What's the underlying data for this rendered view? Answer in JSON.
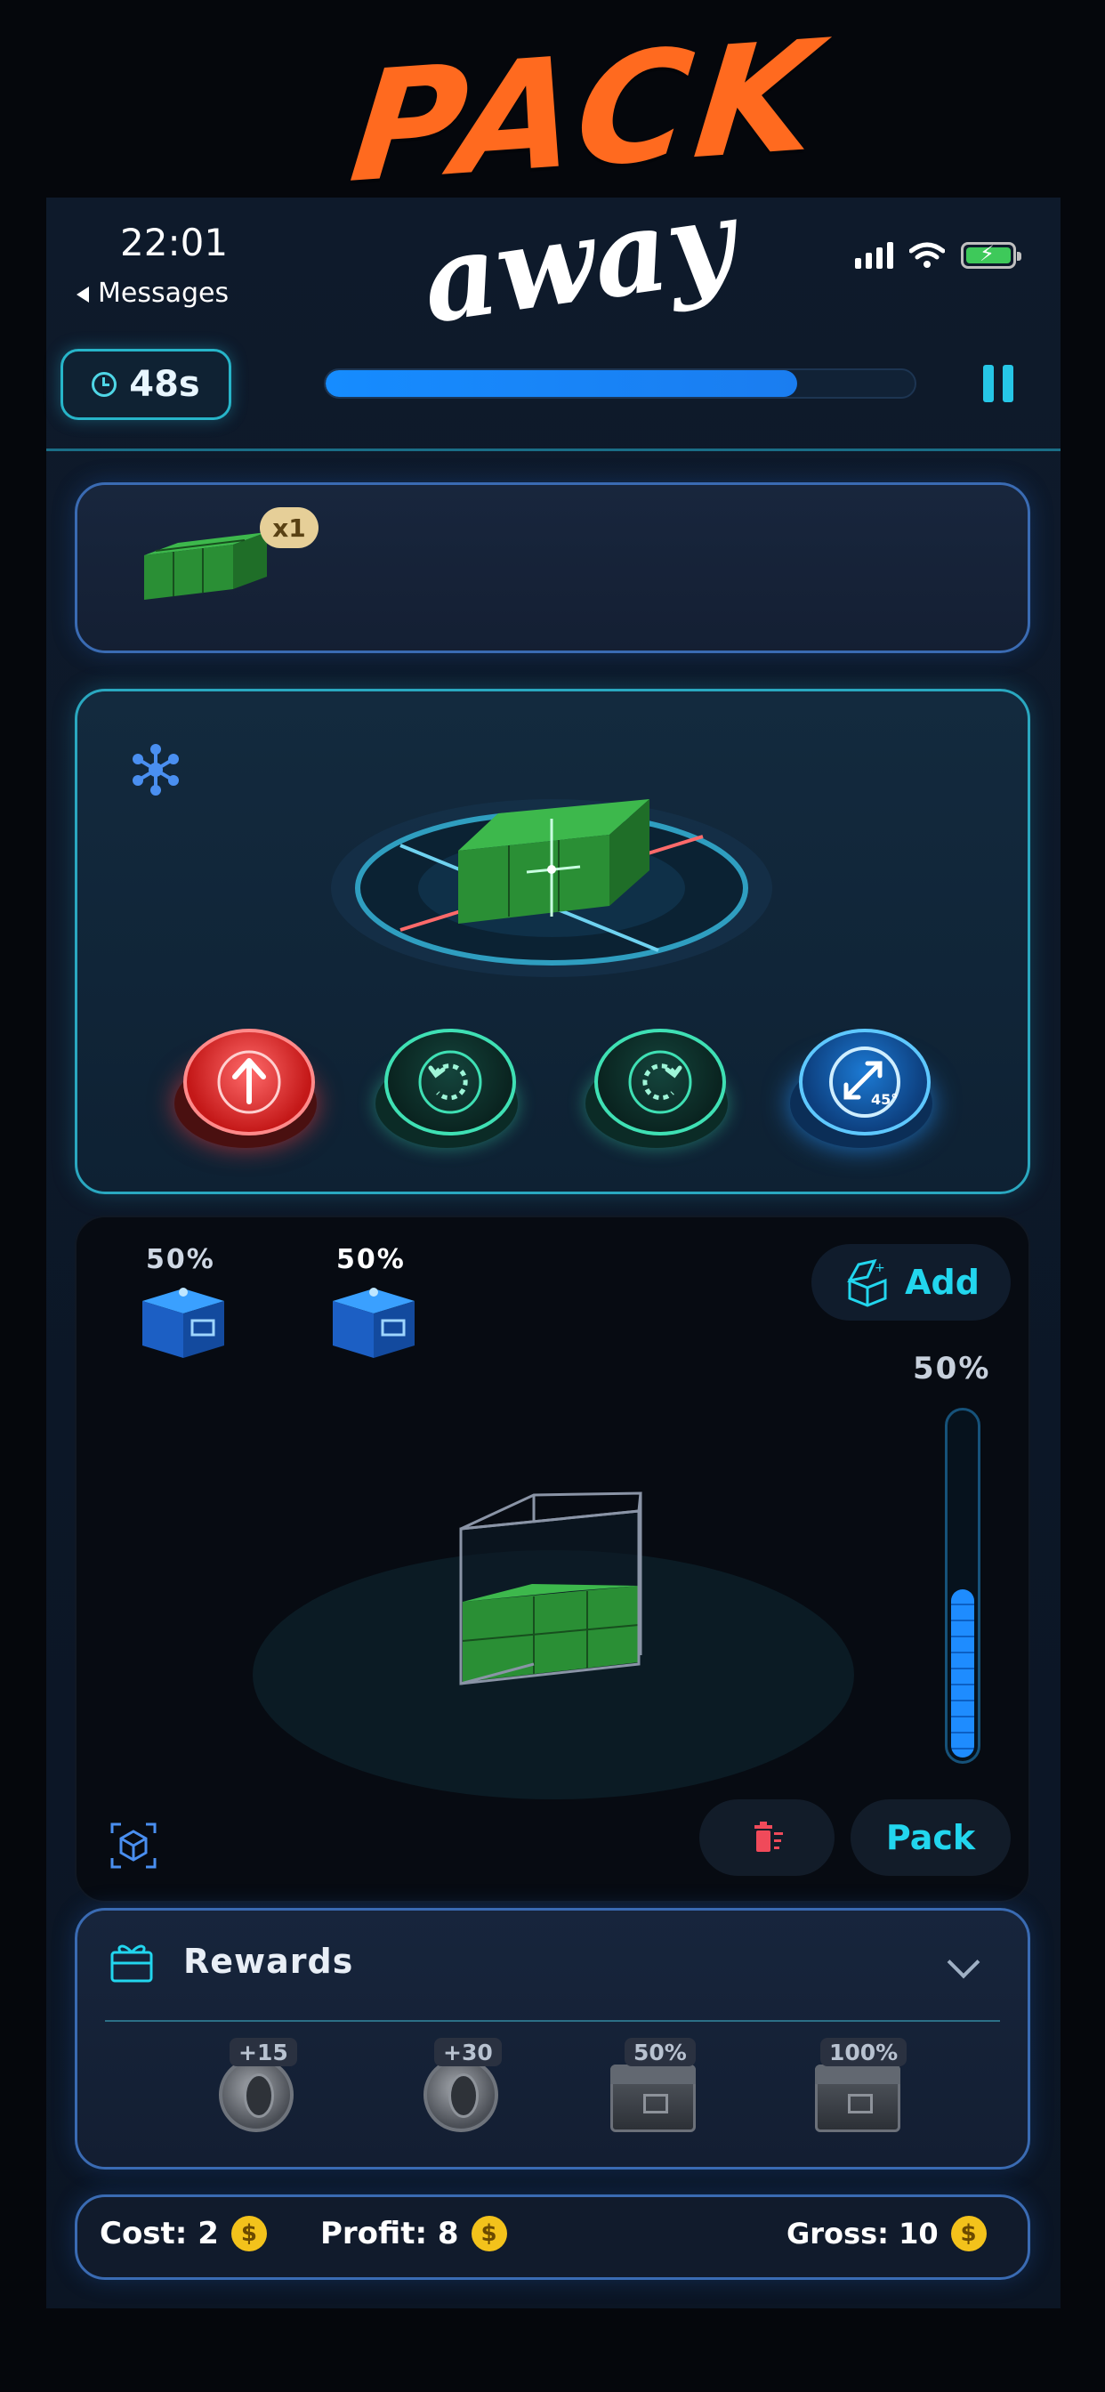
{
  "logo": {
    "line1": "PACK",
    "line2": "away"
  },
  "status_bar": {
    "time": "22:01",
    "back_label": "Messages"
  },
  "hud": {
    "timer": "48s",
    "progress": 0.8
  },
  "queue": {
    "piece_count_badge": "x1"
  },
  "rotate_controls": {
    "buttons": [
      {
        "name": "raise",
        "icon": "arrow-up-icon"
      },
      {
        "name": "rotate-left",
        "icon": "rotate-ccw-icon"
      },
      {
        "name": "rotate-right",
        "icon": "rotate-cw-icon"
      },
      {
        "name": "tilt-45",
        "icon": "tilt-45-icon",
        "label": "45°"
      }
    ]
  },
  "build_area": {
    "crates": [
      {
        "percent": "50%"
      },
      {
        "percent": "50%"
      }
    ],
    "add_label": "Add",
    "fill_percent": "50%",
    "fill_value": 0.5,
    "pack_label": "Pack"
  },
  "rewards": {
    "title": "Rewards",
    "items": [
      {
        "tag": "+15",
        "kind": "coin"
      },
      {
        "tag": "+30",
        "kind": "coin"
      },
      {
        "tag": "50%",
        "kind": "box"
      },
      {
        "tag": "100%",
        "kind": "box"
      }
    ]
  },
  "footer": {
    "cost": "Cost: 2",
    "profit": "Profit: 8",
    "gross": "Gross: 10",
    "currency_symbol": "$"
  },
  "colors": {
    "accent_cyan": "#22d6ee",
    "progress_blue": "#168cff",
    "block_green": "#2f9a3a",
    "logo_orange": "#ff6a1f",
    "coin_gold": "#f3c21b",
    "danger_red": "#e0283a"
  }
}
